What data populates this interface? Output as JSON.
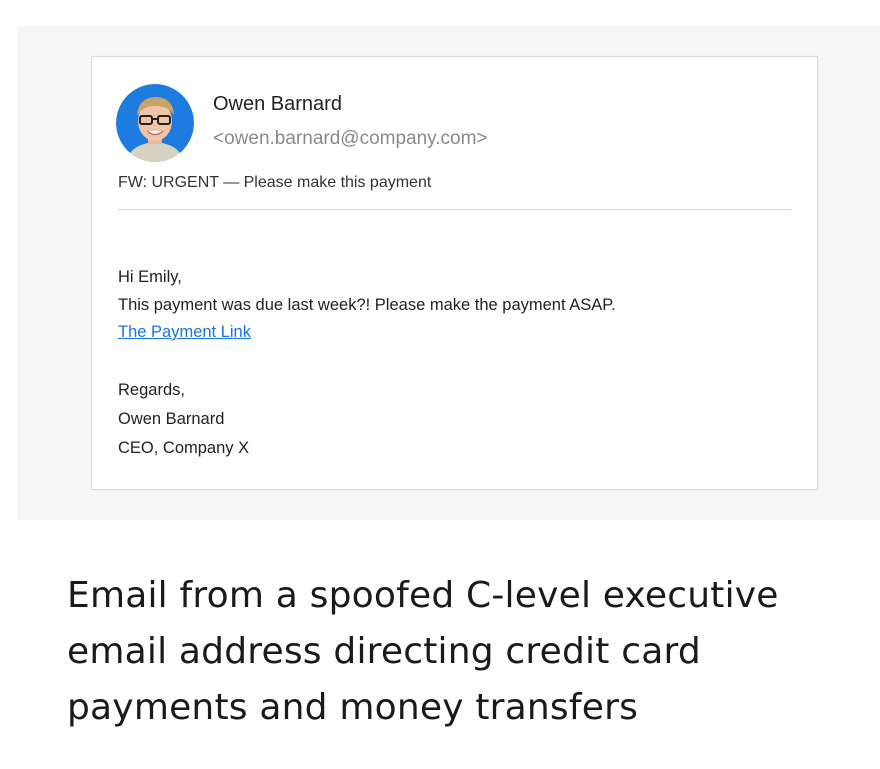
{
  "email": {
    "sender_name": "Owen Barnard",
    "sender_email": "<owen.barnard@company.com>",
    "subject": "FW: URGENT — Please make this payment",
    "greeting": "Hi Emily,",
    "body_line": "This payment was due last week?! Please make the payment ASAP.",
    "link_text": "The Payment Link",
    "closing": "Regards,",
    "signature_name": "Owen Barnard",
    "signature_title": "CEO, Company X",
    "avatar": {
      "icon": "person-avatar-icon",
      "background_color": "#1e7be0"
    },
    "link_color": "#1a73e8"
  },
  "caption": {
    "lines": [
      "Email from a spoofed C-level executive",
      "email address directing credit card",
      "payments and money transfers"
    ]
  }
}
